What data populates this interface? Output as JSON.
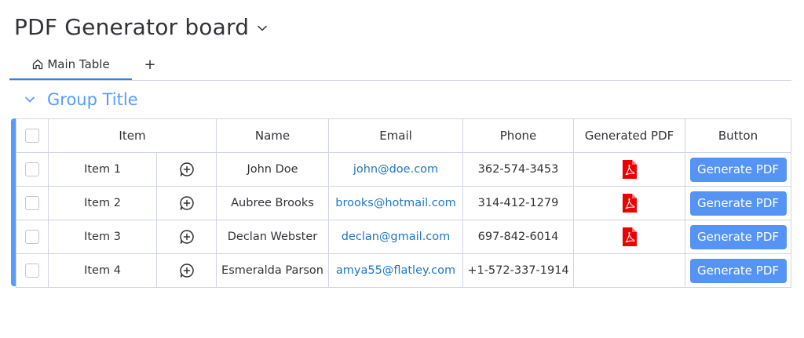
{
  "board": {
    "title": "PDF Generator board"
  },
  "tabs": {
    "main_label": "Main Table",
    "add_label": "+"
  },
  "group": {
    "title": "Group Title",
    "color": "#579bfc"
  },
  "table": {
    "headers": {
      "item": "Item",
      "name": "Name",
      "email": "Email",
      "phone": "Phone",
      "generated_pdf": "Generated PDF",
      "button": "Button"
    },
    "rows": [
      {
        "item": "Item 1",
        "name": "John Doe",
        "email": "john@doe.com",
        "phone": "362-574-3453",
        "has_pdf": true,
        "button": "Generate PDF"
      },
      {
        "item": "Item 2",
        "name": "Aubree Brooks",
        "email": "brooks@hotmail.com",
        "phone": "314-412-1279",
        "has_pdf": true,
        "button": "Generate PDF"
      },
      {
        "item": "Item 3",
        "name": "Declan Webster",
        "email": "declan@gmail.com",
        "phone": "697-842-6014",
        "has_pdf": true,
        "button": "Generate PDF"
      },
      {
        "item": "Item 4",
        "name": "Esmeralda Parson",
        "email": "amya55@flatley.com",
        "phone": "+1-572-337-1914",
        "has_pdf": false,
        "button": "Generate PDF"
      }
    ]
  },
  "icons": {
    "home": "home-icon",
    "title_chevron": "chevron-down-icon",
    "group_chevron": "chevron-down-icon",
    "conversation": "add-update-icon",
    "pdf": "pdf-file-icon"
  },
  "colors": {
    "accent": "#579bfc",
    "button": "#5593f4",
    "link": "#1f76c2",
    "pdf": "#ee0000"
  }
}
